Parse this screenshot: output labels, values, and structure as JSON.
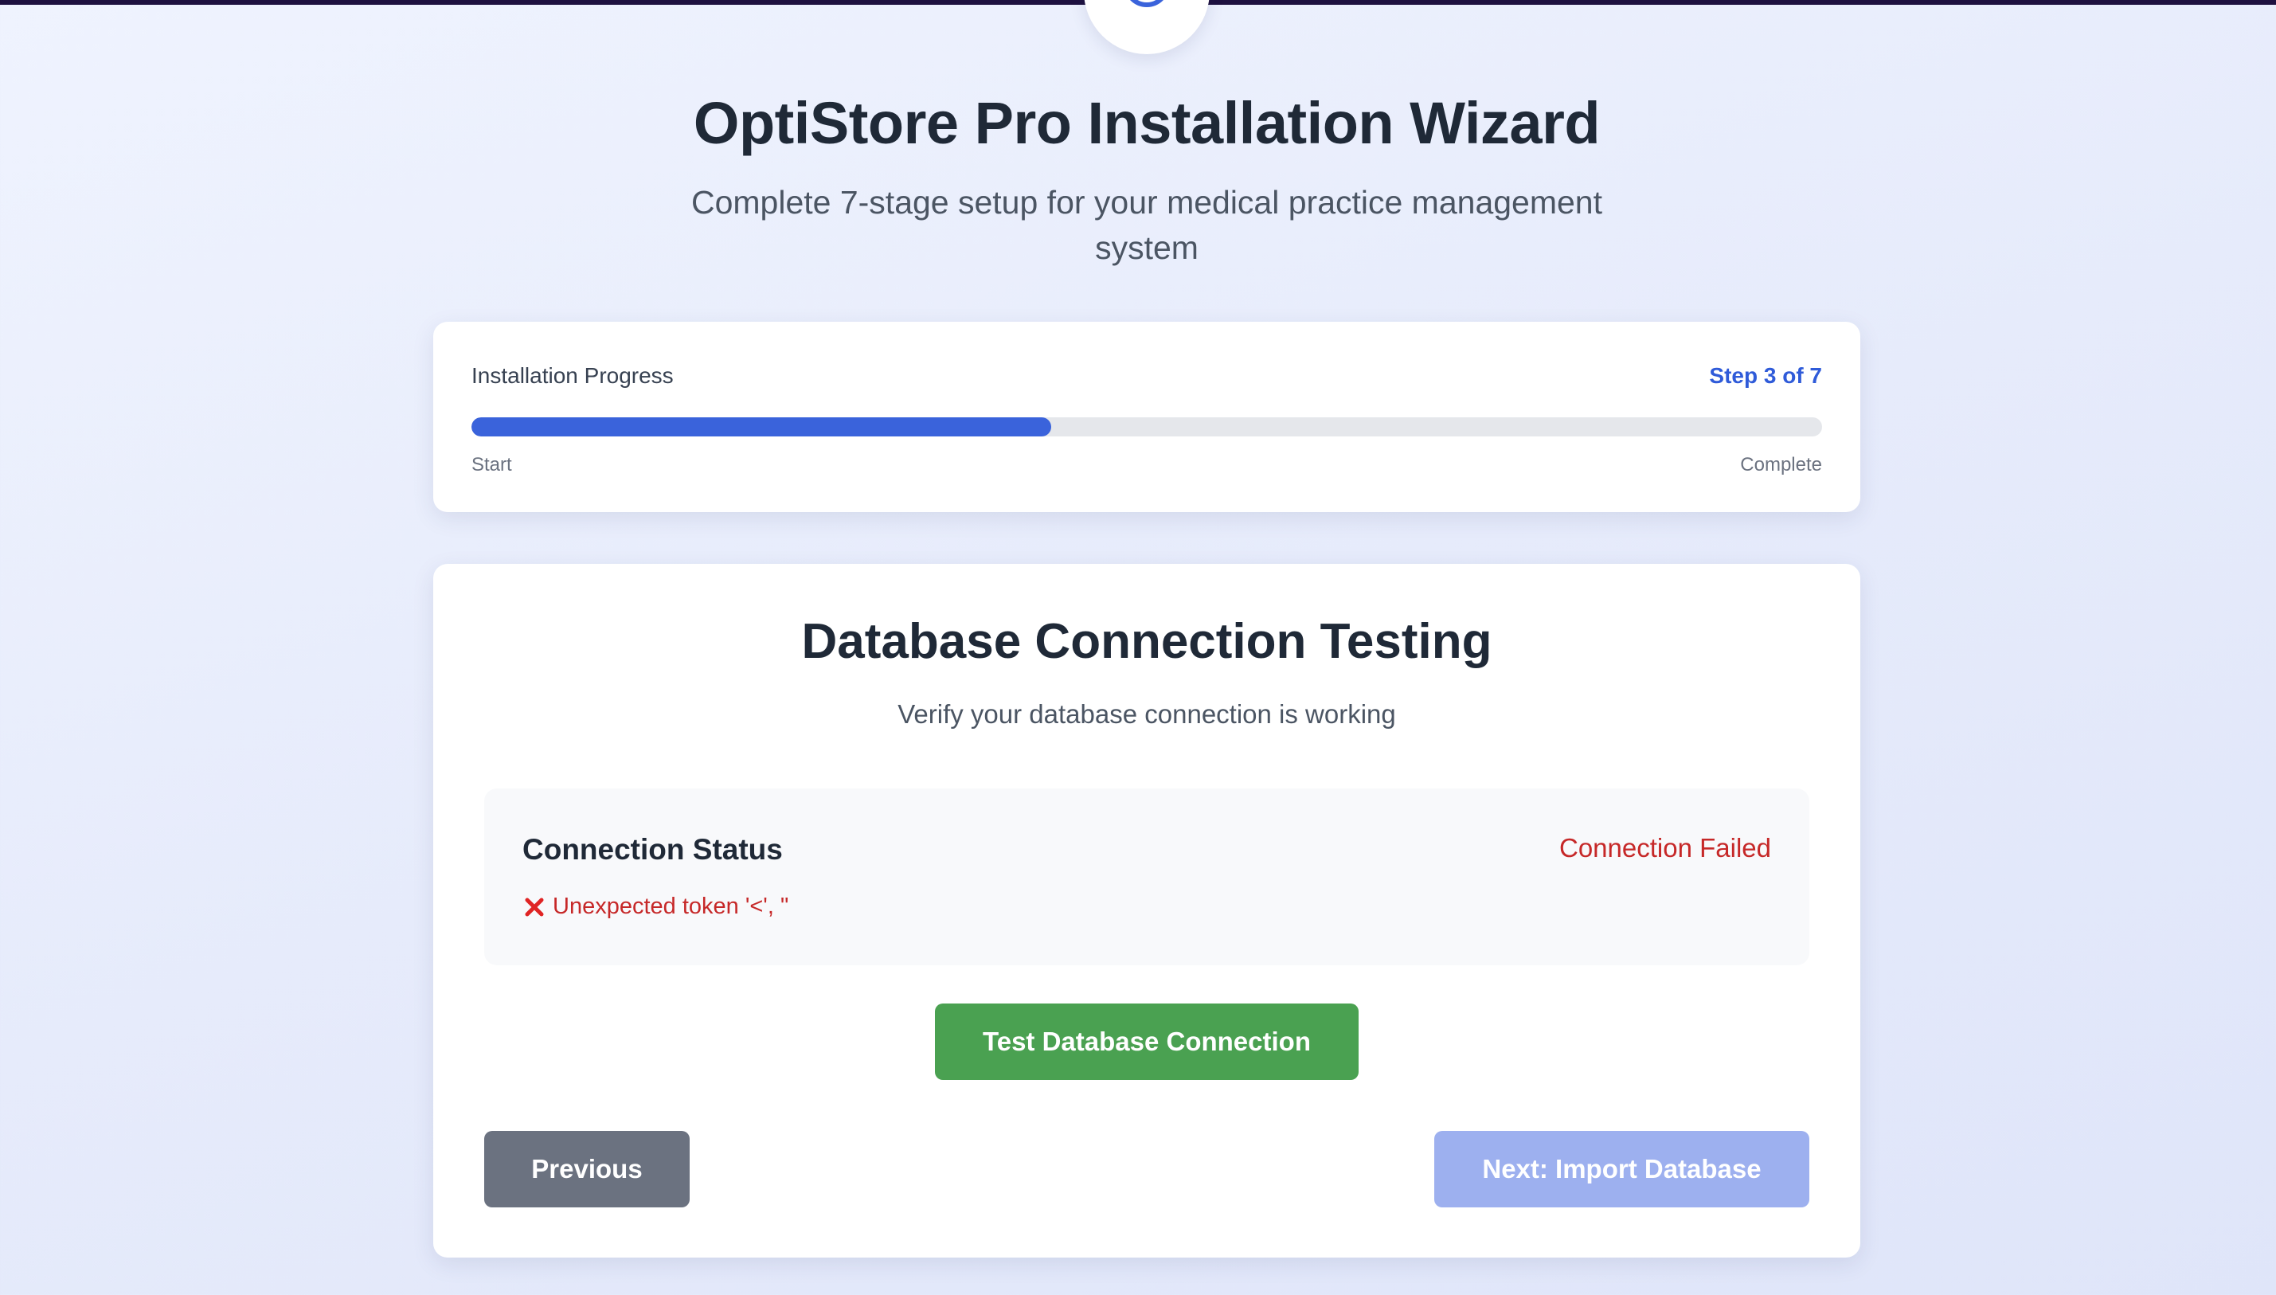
{
  "header": {
    "title": "OptiStore Pro Installation Wizard",
    "subtitle": "Complete 7-stage setup for your medical practice management system"
  },
  "progress": {
    "label": "Installation Progress",
    "step_text": "Step 3 of 7",
    "percent": 42.9,
    "start_label": "Start",
    "end_label": "Complete"
  },
  "step": {
    "title": "Database Connection Testing",
    "subtitle": "Verify your database connection is working",
    "status": {
      "title": "Connection Status",
      "value": "Connection Failed",
      "error": "Unexpected token '<', \""
    },
    "test_button": "Test Database Connection"
  },
  "nav": {
    "previous": "Previous",
    "next": "Next: Import Database"
  },
  "colors": {
    "accent": "#3a63db",
    "success": "#4aa151",
    "error": "#c62828",
    "secondary": "#6b7280",
    "disabled": "#9db0ef"
  },
  "icons": {
    "logo": "spinner-icon",
    "error": "x-mark-icon"
  }
}
